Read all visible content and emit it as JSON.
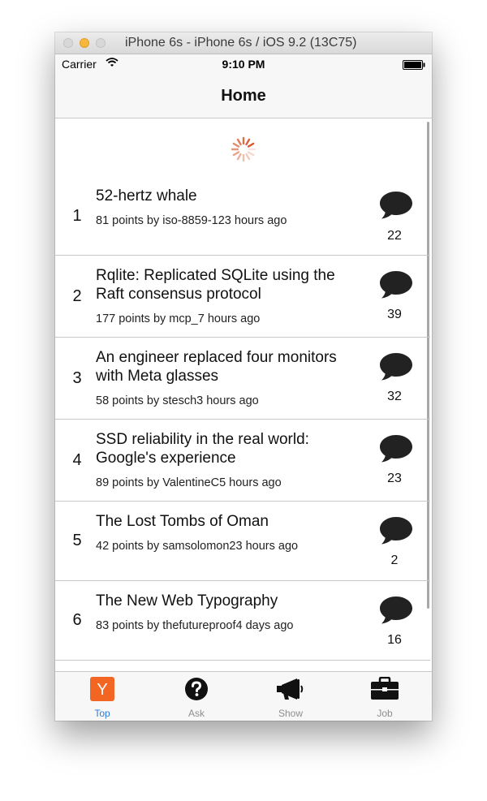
{
  "window": {
    "title": "iPhone 6s - iPhone 6s / iOS 9.2 (13C75)"
  },
  "status_bar": {
    "carrier": "Carrier",
    "time": "9:10 PM"
  },
  "nav": {
    "title": "Home"
  },
  "stories": [
    {
      "rank": "1",
      "title": "52-hertz whale",
      "meta": "81 points by iso-8859-123 hours ago",
      "comments": "22"
    },
    {
      "rank": "2",
      "title": "Rqlite: Replicated SQLite using the Raft consensus protocol",
      "meta": "177 points by mcp_7 hours ago",
      "comments": "39"
    },
    {
      "rank": "3",
      "title": "An engineer replaced four monitors with Meta glasses",
      "meta": "58 points by stesch3 hours ago",
      "comments": "32"
    },
    {
      "rank": "4",
      "title": "SSD reliability in the real world: Google's experience",
      "meta": "89 points by ValentineC5 hours ago",
      "comments": "23"
    },
    {
      "rank": "5",
      "title": "The Lost Tombs of Oman",
      "meta": "42 points by samsolomon23 hours ago",
      "comments": "2"
    },
    {
      "rank": "6",
      "title": "The New Web Typography",
      "meta": "83 points by thefutureproof4 days ago",
      "comments": "16"
    }
  ],
  "tabs": [
    {
      "label": "Top",
      "icon": "y-logo-icon",
      "active": true
    },
    {
      "label": "Ask",
      "icon": "question-circle-icon",
      "active": false
    },
    {
      "label": "Show",
      "icon": "megaphone-icon",
      "active": false
    },
    {
      "label": "Job",
      "icon": "briefcase-icon",
      "active": false
    }
  ],
  "tab_icons": {
    "top_logo_letter": "Y"
  },
  "colors": {
    "accent": "#2f7ad8",
    "hn_orange": "#f26522",
    "spinner": "#d9542b"
  }
}
